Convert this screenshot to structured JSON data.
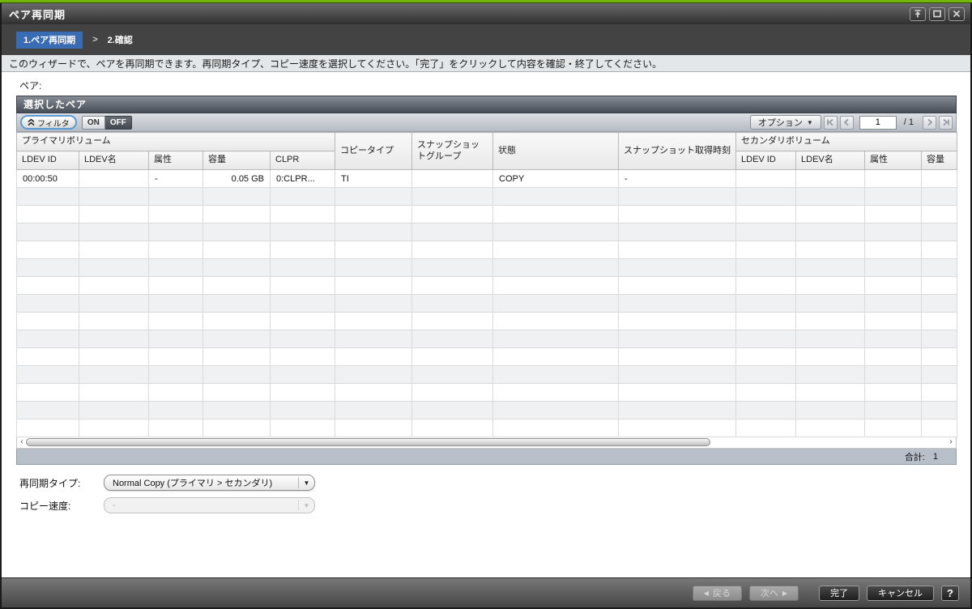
{
  "window": {
    "title": "ペア再同期"
  },
  "steps": {
    "step1": "1.ペア再同期",
    "separator": ">",
    "step2": "2.確認"
  },
  "instruction": "このウィザードで、ペアを再同期できます。再同期タイプ、コピー速度を選択してください。「完了」をクリックして内容を確認・終了してください。",
  "pair_section_label": "ペア:",
  "table": {
    "title": "選択したペア",
    "filter_button": "フィルタ",
    "filter_on": "ON",
    "filter_off": "OFF",
    "options_button": "オプション",
    "pagination": {
      "current_page": "1",
      "page_separator": "/ 1"
    },
    "header": {
      "primary_volume_group": "プライマリボリューム",
      "secondary_volume_group": "セカンダリボリューム",
      "copy_type": "コピータイプ",
      "snapshot_group": "スナップショットグループ",
      "status": "状態",
      "snapshot_time": "スナップショット取得時刻",
      "primary_columns": [
        "LDEV ID",
        "LDEV名",
        "属性",
        "容量",
        "CLPR"
      ],
      "secondary_columns": [
        "LDEV ID",
        "LDEV名",
        "属性",
        "容量"
      ]
    },
    "rows": [
      {
        "ldev_id": "00:00:50",
        "ldev_name": "",
        "attribute": "-",
        "capacity": "0.05 GB",
        "clpr": "0:CLPR...",
        "copy_type": "TI",
        "snapshot_group": "",
        "status": "COPY",
        "snapshot_time": "-",
        "sec_ldev_id": "",
        "sec_ldev_name": "",
        "sec_attribute": "",
        "sec_capacity": ""
      }
    ],
    "empty_row_count": 14,
    "total_label": "合計:",
    "total_value": "1"
  },
  "form": {
    "resync_type_label": "再同期タイプ:",
    "resync_type_value": "Normal Copy (プライマリ > セカンダリ)",
    "copy_pace_label": "コピー速度:",
    "copy_pace_value": "-"
  },
  "footer": {
    "back": "戻る",
    "next": "次へ",
    "finish": "完了",
    "cancel": "キャンセル",
    "help": "?"
  },
  "colors": {
    "accent_green": "#74b70b",
    "step_active_blue": "#3a6cb4",
    "table_header_bar": "#5b616b",
    "total_bar_gray": "#b9bfc8",
    "filter_focus_blue": "#5b9bd5"
  }
}
